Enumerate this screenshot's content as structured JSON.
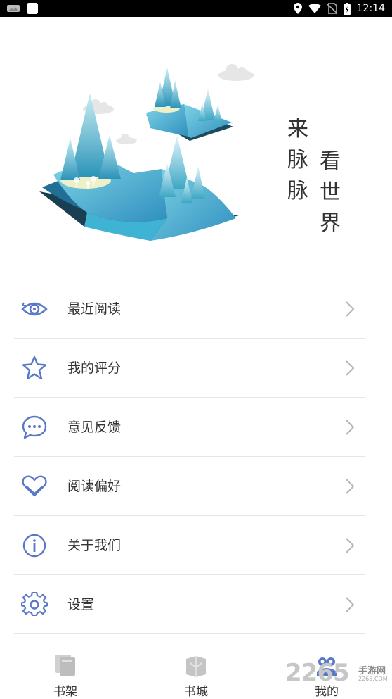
{
  "status_bar": {
    "time": "12:14"
  },
  "hero": {
    "slogan_line1": [
      "来",
      "脉",
      "脉"
    ],
    "slogan_line2": [
      "看",
      "世",
      "界"
    ]
  },
  "menu": {
    "items": [
      {
        "label": "最近阅读",
        "icon": "eye-icon"
      },
      {
        "label": "我的评分",
        "icon": "star-icon"
      },
      {
        "label": "意见反馈",
        "icon": "chat-bubble-icon"
      },
      {
        "label": "阅读偏好",
        "icon": "heart-icon"
      },
      {
        "label": "关于我们",
        "icon": "info-icon"
      },
      {
        "label": "设置",
        "icon": "gear-icon"
      }
    ]
  },
  "tabbar": {
    "tabs": [
      {
        "label": "书架",
        "icon": "bookshelf-icon"
      },
      {
        "label": "书城",
        "icon": "bookstore-icon"
      },
      {
        "label": "我的",
        "icon": "profile-icon"
      }
    ]
  },
  "watermark": {
    "number": "2265",
    "text": "手游网",
    "url": "2265.COM"
  },
  "colors": {
    "accent_icon": "#5a78c8",
    "text": "#333333",
    "divider": "#e6e6e6",
    "arrow": "#b5b5b5"
  }
}
